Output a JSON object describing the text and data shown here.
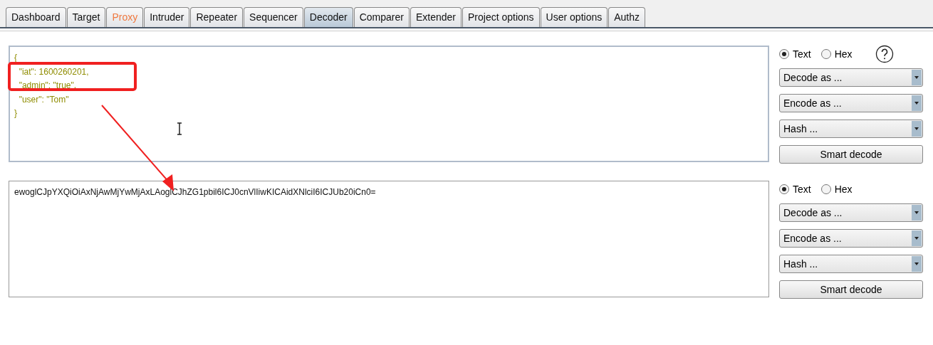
{
  "tabs": [
    {
      "label": "Dashboard",
      "selected": false,
      "highlighted": false
    },
    {
      "label": "Target",
      "selected": false,
      "highlighted": false
    },
    {
      "label": "Proxy",
      "selected": false,
      "highlighted": true
    },
    {
      "label": "Intruder",
      "selected": false,
      "highlighted": false
    },
    {
      "label": "Repeater",
      "selected": false,
      "highlighted": false
    },
    {
      "label": "Sequencer",
      "selected": false,
      "highlighted": false
    },
    {
      "label": "Decoder",
      "selected": true,
      "highlighted": false
    },
    {
      "label": "Comparer",
      "selected": false,
      "highlighted": false
    },
    {
      "label": "Extender",
      "selected": false,
      "highlighted": false
    },
    {
      "label": "Project options",
      "selected": false,
      "highlighted": false
    },
    {
      "label": "User options",
      "selected": false,
      "highlighted": false
    },
    {
      "label": "Authz",
      "selected": false,
      "highlighted": false
    }
  ],
  "panels": [
    {
      "lines": [
        "{",
        "  \"iat\": 1600260201,",
        "  \"admin\": \"true\",",
        "  \"user\": \"Tom\"",
        "}"
      ],
      "modes": [
        {
          "label": "Text",
          "selected": true
        },
        {
          "label": "Hex",
          "selected": false
        }
      ],
      "help": true,
      "dropdowns": [
        "Decode as ...",
        "Encode as ...",
        "Hash ..."
      ],
      "button": "Smart decode"
    },
    {
      "lines": [
        "ewoglCJpYXQiOiAxNjAwMjYwMjAxLAoglCJhZG1pbil6ICJ0cnVlIiwKICAidXNlciI6ICJUb20iCn0="
      ],
      "modes": [
        {
          "label": "Text",
          "selected": true
        },
        {
          "label": "Hex",
          "selected": false
        }
      ],
      "help": false,
      "dropdowns": [
        "Decode as ...",
        "Encode as ...",
        "Hash ..."
      ],
      "button": "Smart decode"
    }
  ]
}
